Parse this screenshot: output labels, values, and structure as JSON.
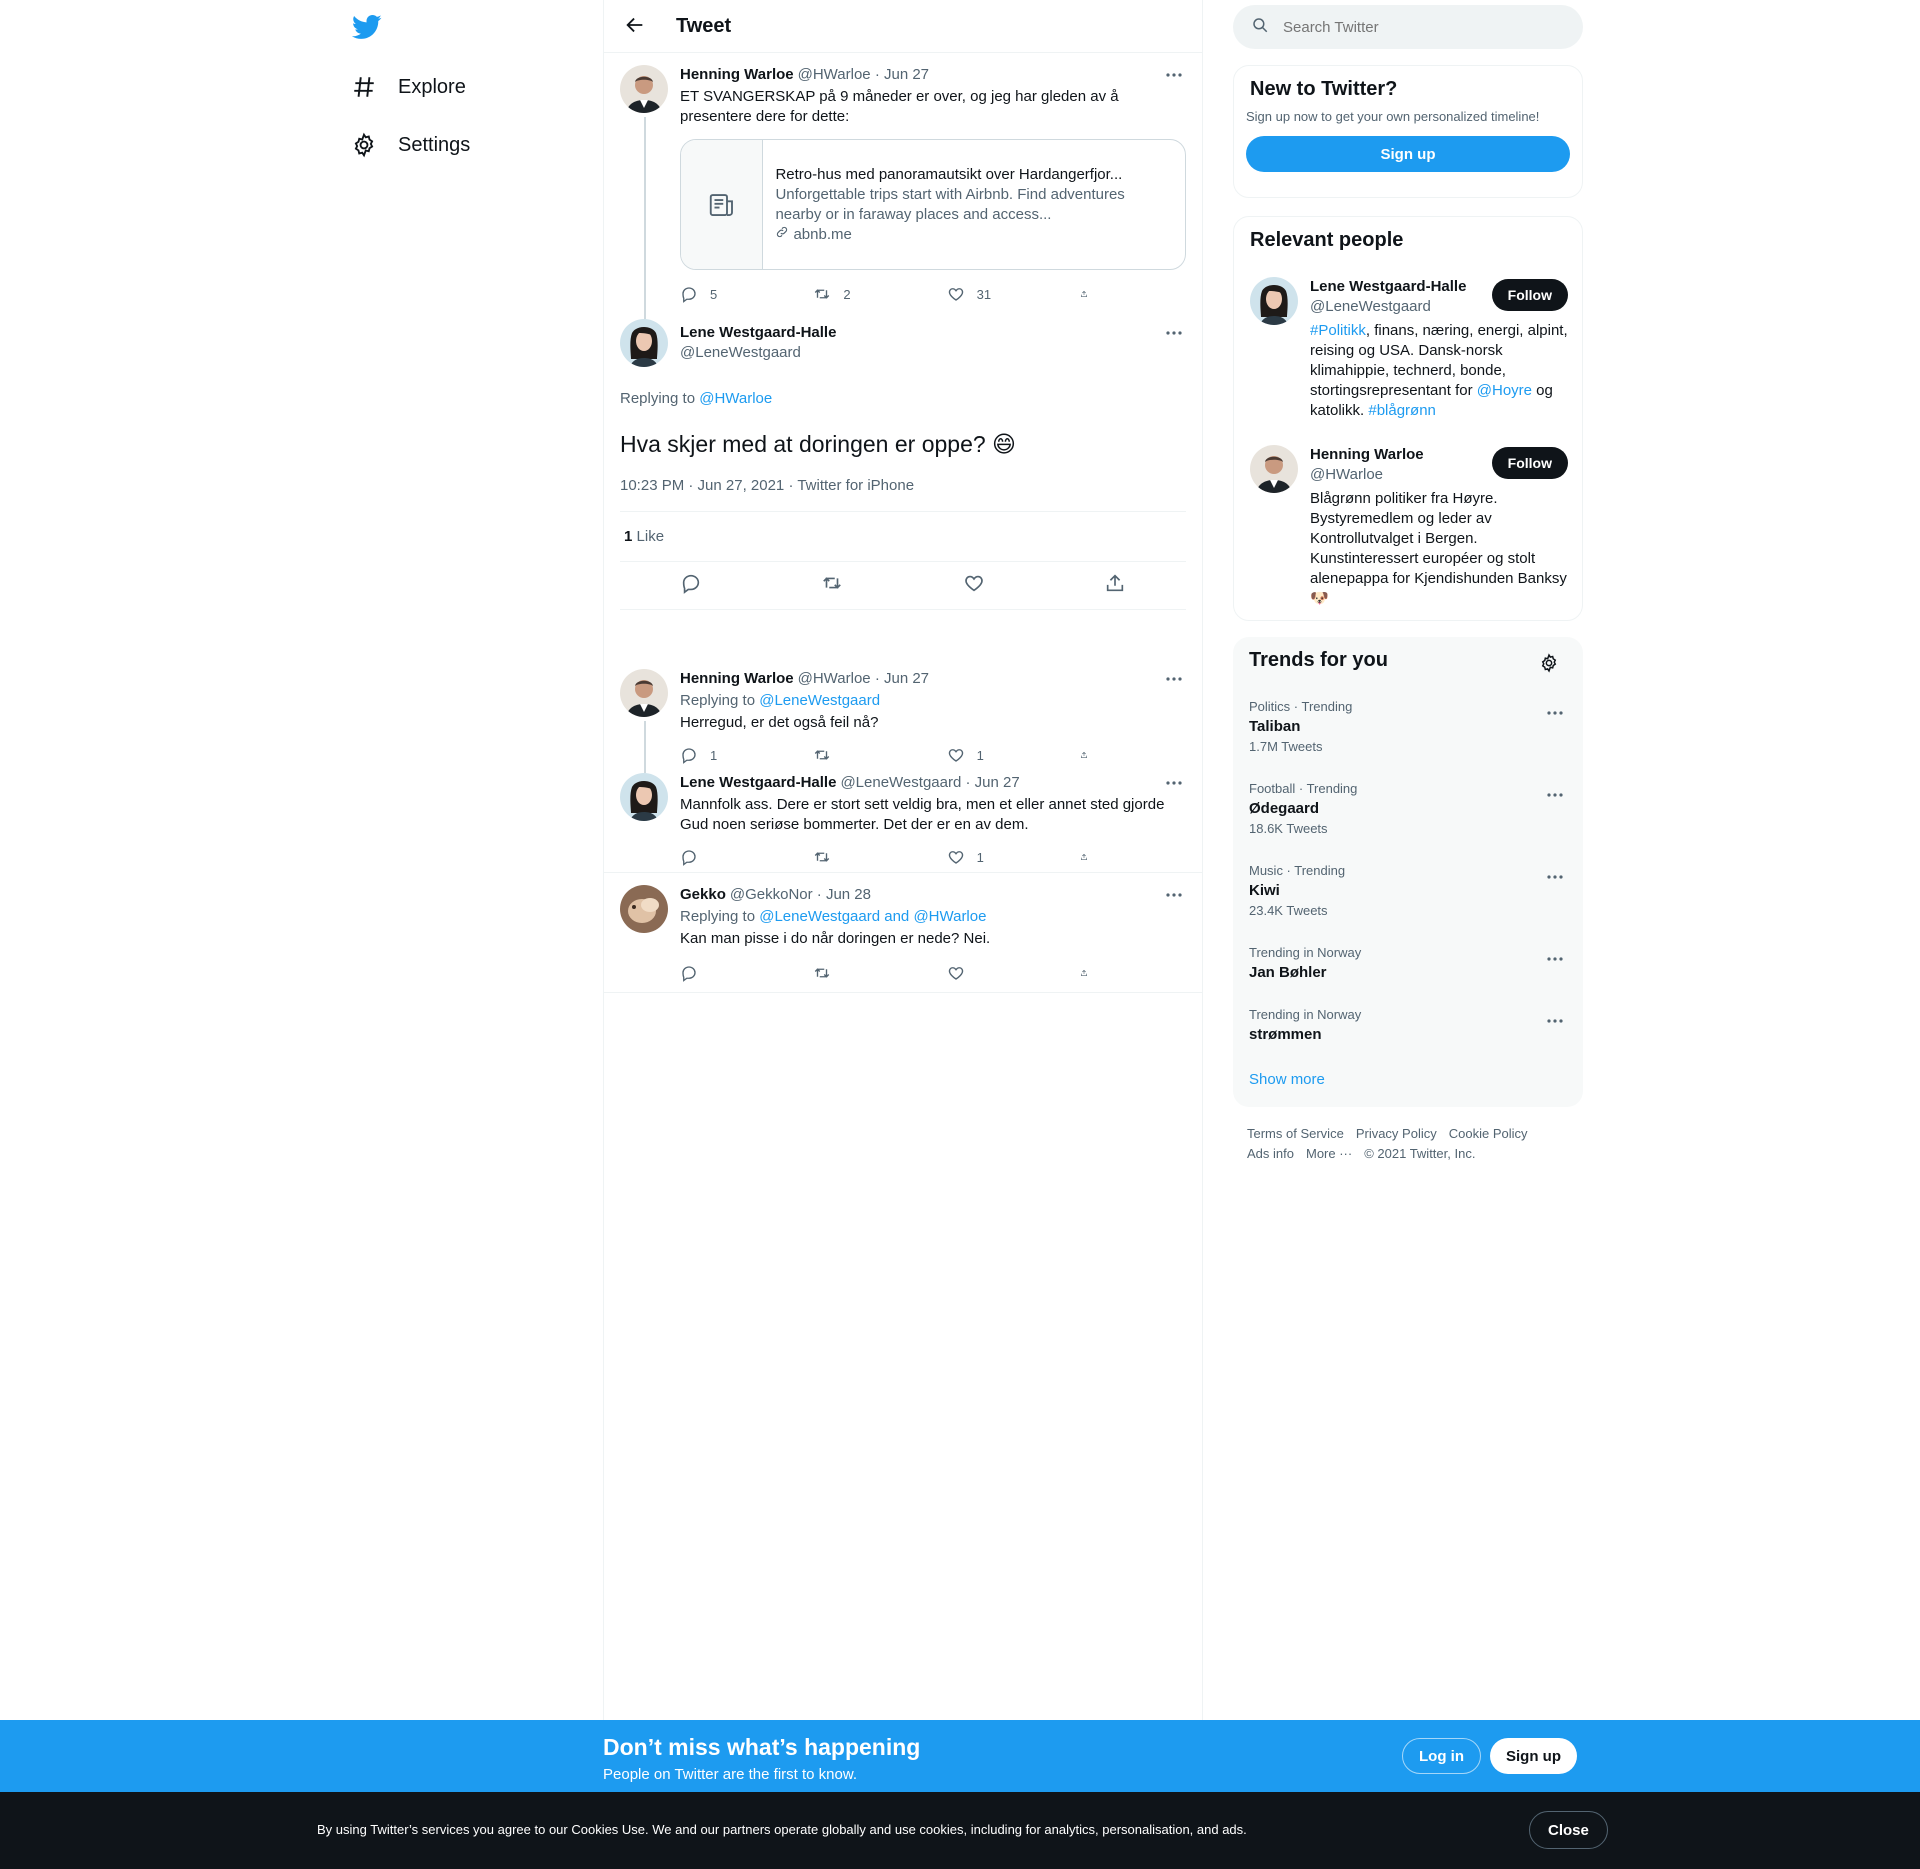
{
  "nav": {
    "explore_label": "Explore",
    "settings_label": "Settings"
  },
  "header": {
    "title": "Tweet"
  },
  "thread": {
    "parent": {
      "name": "Henning Warloe",
      "handle": "@HWarloe",
      "date": "· Jun 27",
      "text": "ET SVANGERSKAP på 9 måneder er over, og jeg har gleden av å presentere dere for dette:",
      "card": {
        "title": "Retro-hus med panoramautsikt over Hardangerfjor...",
        "description": "Unforgettable trips start with Airbnb. Find adventures nearby or in faraway places and access...",
        "domain": "abnb.me"
      },
      "replies": "5",
      "retweets": "2",
      "likes": "31"
    },
    "main": {
      "name": "Lene Westgaard-Halle",
      "handle": "@LeneWestgaard",
      "replying_prefix": "Replying to",
      "replying_to": "@HWarloe",
      "text": "Hva skjer med at doringen er oppe?",
      "emoji": "😄",
      "meta": "10:23 PM · Jun 27, 2021 · Twitter for iPhone",
      "like_count": "1",
      "like_label": "Like"
    },
    "replies": [
      {
        "name": "Henning Warloe",
        "handle": "@HWarloe",
        "date": "· Jun 27",
        "replying_prefix": "Replying to",
        "replying_to": "@LeneWestgaard",
        "text": "Herregud, er det også feil nå?",
        "replies": "1",
        "retweets": "",
        "likes": "1"
      },
      {
        "name": "Lene Westgaard-Halle",
        "handle": "@LeneWestgaard",
        "date": "· Jun 27",
        "text": "Mannfolk ass. Dere er stort sett veldig bra, men et eller annet sted gjorde Gud noen seriøse bommerter. Det der er en av dem.",
        "replies": "",
        "retweets": "",
        "likes": "1"
      },
      {
        "name": "Gekko",
        "handle": "@GekkoNor",
        "date": "· Jun 28",
        "replying_prefix": "Replying to",
        "replying_to": "@LeneWestgaard and @HWarloe",
        "text": "Kan man pisse i do når doringen er nede? Nei.",
        "replies": "",
        "retweets": "",
        "likes": ""
      }
    ]
  },
  "search": {
    "placeholder": "Search Twitter"
  },
  "new_to_twitter": {
    "title": "New to Twitter?",
    "subtitle": "Sign up now to get your own personalized timeline!",
    "button": "Sign up"
  },
  "relevant_people": {
    "title": "Relevant people",
    "follow_label": "Follow",
    "people": [
      {
        "name": "Lene Westgaard-Halle",
        "handle": "@LeneWestgaard",
        "bio_tag1": "#Politikk",
        "bio_part1": ", finans, næring, energi, alpint, reising og USA. Dansk-norsk klimahippie, technerd, bonde, stortingsrepresentant for ",
        "bio_mention": "@Hoyre",
        "bio_part2": " og katolikk. ",
        "bio_tag2": "#blågrønn"
      },
      {
        "name": "Henning Warloe",
        "handle": "@HWarloe",
        "bio": "Blågrønn politiker fra Høyre. Bystyremedlem og leder av Kontrollutvalget i Bergen. Kunstinteressert européer og stolt alenepappa for Kjendishunden Banksy",
        "bio_emoji": "🐶"
      }
    ]
  },
  "trends": {
    "title": "Trends for you",
    "items": [
      {
        "context": "Politics · Trending",
        "name": "Taliban",
        "count": "1.7M Tweets"
      },
      {
        "context": "Football · Trending",
        "name": "Ødegaard",
        "count": "18.6K Tweets"
      },
      {
        "context": "Music · Trending",
        "name": "Kiwi",
        "count": "23.4K Tweets"
      },
      {
        "context": "Trending in Norway",
        "name": "Jan Bøhler",
        "count": ""
      },
      {
        "context": "Trending in Norway",
        "name": "strømmen",
        "count": ""
      }
    ],
    "show_more": "Show more"
  },
  "footer": {
    "terms": "Terms of Service",
    "privacy": "Privacy Policy",
    "cookie": "Cookie Policy",
    "ads": "Ads info",
    "more": "More ···",
    "copyright": "© 2021 Twitter, Inc."
  },
  "banner": {
    "title": "Don’t miss what’s happening",
    "subtitle": "People on Twitter are the first to know.",
    "login": "Log in",
    "signup": "Sign up"
  },
  "cookies": {
    "text": "By using Twitter’s services you agree to our Cookies Use. We and our partners operate globally and use cookies, including for analytics, personalisation, and ads.",
    "close": "Close"
  },
  "colors": {
    "accent": "#1d9bf0",
    "text": "#0f1419",
    "muted": "#536471",
    "border": "#eff3f4"
  }
}
